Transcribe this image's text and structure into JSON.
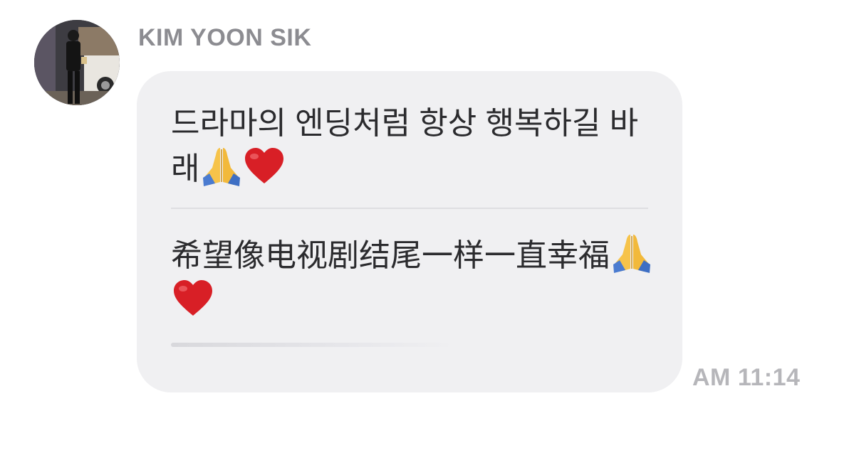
{
  "message": {
    "sender_name": "KIM YOON SIK",
    "line_korean": "드라마의 엔딩처럼 항상 행복하길 바래",
    "line_chinese": "希望像电视剧结尾一样一直幸福",
    "emojis": [
      "folded-hands-icon",
      "red-heart-icon"
    ],
    "time": "AM 11:14"
  },
  "colors": {
    "bubble": "#f0f0f2",
    "name": "#8c8c91",
    "time": "#b6b6ba",
    "text": "#2b2b2e"
  }
}
